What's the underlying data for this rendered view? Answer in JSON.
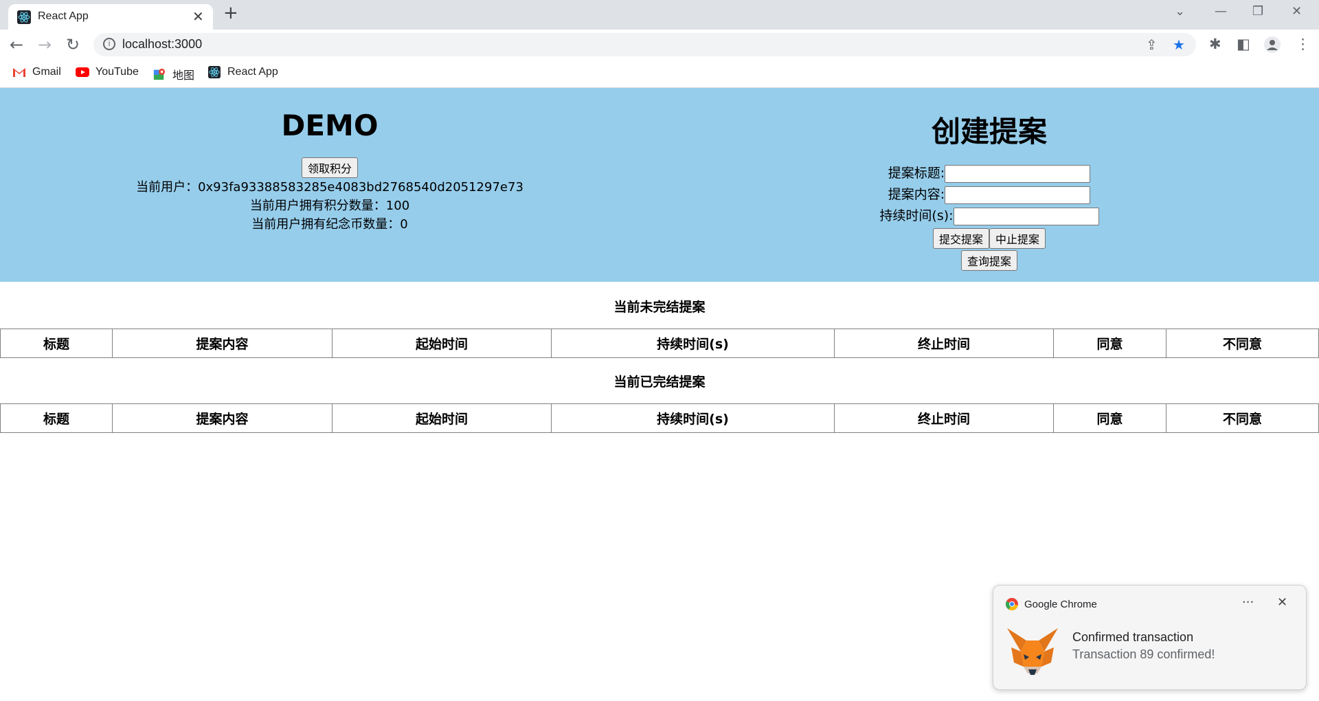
{
  "browser": {
    "tab_title": "React App",
    "url": "localhost:3000",
    "bookmarks": [
      {
        "label": "Gmail",
        "icon": "gmail-icon"
      },
      {
        "label": "YouTube",
        "icon": "youtube-icon"
      },
      {
        "label": "地图",
        "icon": "maps-icon"
      },
      {
        "label": "React App",
        "icon": "react-icon"
      }
    ]
  },
  "left": {
    "title": "DEMO",
    "claim_button": "领取积分",
    "current_user": "当前用户：0x93fa93388583285e4083bd2768540d2051297e73",
    "points": "当前用户拥有积分数量：100",
    "coins": "当前用户拥有纪念币数量：0"
  },
  "right": {
    "title": "创建提案",
    "title_label": "提案标题:",
    "content_label": "提案内容:",
    "duration_label": "持续时间(s):",
    "submit_button": "提交提案",
    "stop_button": "中止提案",
    "query_button": "查询提案"
  },
  "ongoing": {
    "heading": "当前未完结提案",
    "columns": [
      "标题",
      "提案内容",
      "起始时间",
      "持续时间(s)",
      "终止时间",
      "同意",
      "不同意"
    ]
  },
  "finished": {
    "heading": "当前已完结提案",
    "columns": [
      "标题",
      "提案内容",
      "起始时间",
      "持续时间(s)",
      "终止时间",
      "同意",
      "不同意"
    ]
  },
  "notification": {
    "app": "Google Chrome",
    "title": "Confirmed transaction",
    "body": "Transaction 89 confirmed!"
  },
  "colors": {
    "hero_bg": "#96cdeb",
    "star": "#1a73e8"
  }
}
